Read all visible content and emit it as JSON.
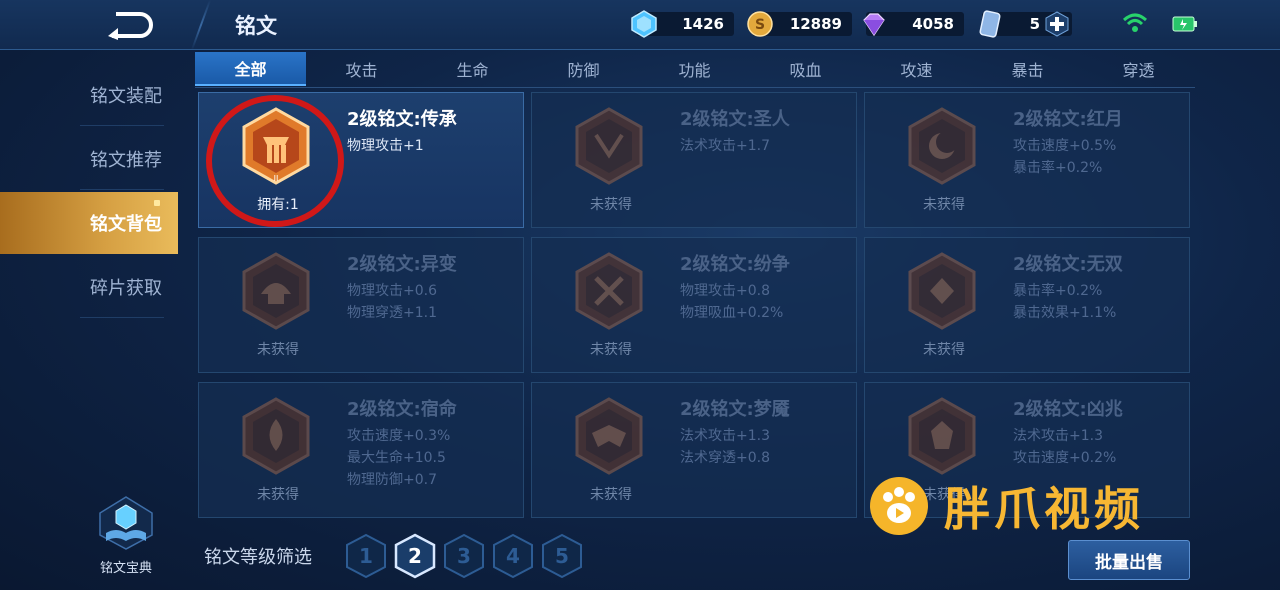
{
  "header": {
    "title": "铭文",
    "currencies": [
      {
        "icon": "blue-crystal-icon",
        "value": "1426"
      },
      {
        "icon": "gold-coin-icon",
        "value": "12889"
      },
      {
        "icon": "purple-diamond-icon",
        "value": "4058"
      },
      {
        "icon": "card-icon",
        "value": "5"
      }
    ]
  },
  "sidebar": {
    "items": [
      {
        "label": "铭文装配"
      },
      {
        "label": "铭文推荐"
      },
      {
        "label": "铭文背包"
      },
      {
        "label": "碎片获取"
      }
    ],
    "codex_label": "铭文宝典"
  },
  "tabs": [
    "全部",
    "攻击",
    "生命",
    "防御",
    "功能",
    "吸血",
    "攻速",
    "暴击",
    "穿透"
  ],
  "cards": [
    {
      "name": "2级铭文:传承",
      "stats": [
        "物理攻击+1"
      ],
      "status": "拥有:1",
      "owned": true
    },
    {
      "name": "2级铭文:圣人",
      "stats": [
        "法术攻击+1.7"
      ],
      "status": "未获得",
      "owned": false
    },
    {
      "name": "2级铭文:红月",
      "stats": [
        "攻击速度+0.5%",
        "暴击率+0.2%"
      ],
      "status": "未获得",
      "owned": false
    },
    {
      "name": "2级铭文:异变",
      "stats": [
        "物理攻击+0.6",
        "物理穿透+1.1"
      ],
      "status": "未获得",
      "owned": false
    },
    {
      "name": "2级铭文:纷争",
      "stats": [
        "物理攻击+0.8",
        "物理吸血+0.2%"
      ],
      "status": "未获得",
      "owned": false
    },
    {
      "name": "2级铭文:无双",
      "stats": [
        "暴击率+0.2%",
        "暴击效果+1.1%"
      ],
      "status": "未获得",
      "owned": false
    },
    {
      "name": "2级铭文:宿命",
      "stats": [
        "攻击速度+0.3%",
        "最大生命+10.5",
        "物理防御+0.7"
      ],
      "status": "未获得",
      "owned": false
    },
    {
      "name": "2级铭文:梦魇",
      "stats": [
        "法术攻击+1.3",
        "法术穿透+0.8"
      ],
      "status": "未获得",
      "owned": false
    },
    {
      "name": "2级铭文:凶兆",
      "stats": [
        "法术攻击+1.3",
        "攻击速度+0.2%"
      ],
      "status": "未获得",
      "owned": false
    }
  ],
  "filter": {
    "label": "铭文等级筛选",
    "levels": [
      "1",
      "2",
      "3",
      "4",
      "5"
    ],
    "selected": "2"
  },
  "bulk_sell_label": "批量出售",
  "watermark_text": "胖爪视频",
  "colors": {
    "accent_gold": "#d6a043",
    "tab_active": "#2a74c8",
    "highlight_ring": "#d01818"
  }
}
